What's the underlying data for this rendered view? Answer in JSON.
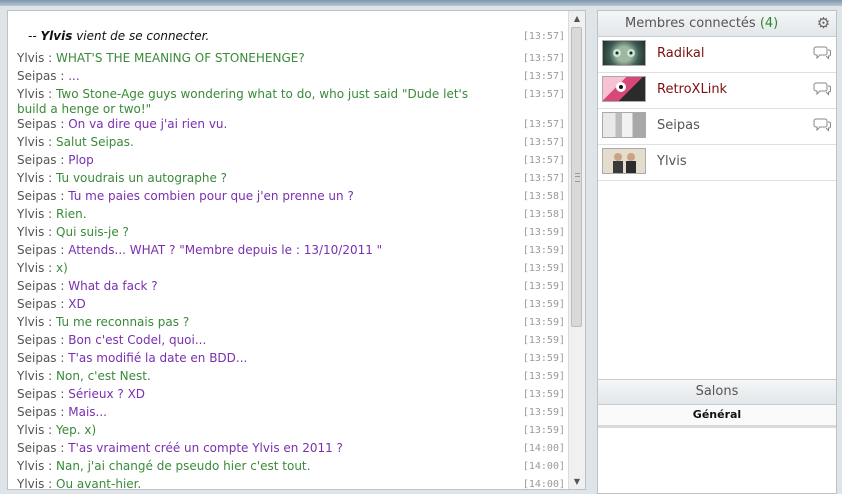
{
  "messages": [
    {
      "type": "system",
      "prefix": "-- ",
      "nick": "Ylvis",
      "text": " vient de se connecter.",
      "time": "[13:57]"
    },
    {
      "nick": "Ylvis",
      "sep": " : ",
      "text": "WHAT'S THE MEANING OF STONEHENGE?",
      "time": "[13:57]"
    },
    {
      "nick": "Seipas",
      "sep": " : ",
      "text": "...",
      "time": "[13:57]"
    },
    {
      "nick": "Ylvis",
      "sep": " : ",
      "text": "Two Stone-Age guys wondering what to do, who just said \"Dude let's build a henge or two!\"",
      "time": "[13:57]"
    },
    {
      "nick": "Seipas",
      "sep": " : ",
      "text": "On va dire que j'ai rien vu.",
      "time": "[13:57]"
    },
    {
      "nick": "Ylvis",
      "sep": " : ",
      "text": "Salut Seipas.",
      "time": "[13:57]"
    },
    {
      "nick": "Seipas",
      "sep": " : ",
      "text": "Plop",
      "time": "[13:57]"
    },
    {
      "nick": "Ylvis",
      "sep": " : ",
      "text": "Tu voudrais un autographe ?",
      "time": "[13:57]"
    },
    {
      "nick": "Seipas",
      "sep": " : ",
      "text": "Tu me paies combien pour que j'en prenne un ?",
      "time": "[13:58]"
    },
    {
      "nick": "Ylvis",
      "sep": " : ",
      "text": "Rien.",
      "time": "[13:58]"
    },
    {
      "nick": "Ylvis",
      "sep": " : ",
      "text": "Qui suis-je ?",
      "time": "[13:59]"
    },
    {
      "nick": "Seipas",
      "sep": " : ",
      "text": "Attends... WHAT ? \"Membre depuis le : 13/10/2011 \"",
      "time": "[13:59]"
    },
    {
      "nick": "Ylvis",
      "sep": " : ",
      "text": "x)",
      "time": "[13:59]"
    },
    {
      "nick": "Seipas",
      "sep": " : ",
      "text": "What da fack ?",
      "time": "[13:59]"
    },
    {
      "nick": "Seipas",
      "sep": " : ",
      "text": "XD",
      "time": "[13:59]"
    },
    {
      "nick": "Ylvis",
      "sep": " : ",
      "text": "Tu me reconnais pas ?",
      "time": "[13:59]"
    },
    {
      "nick": "Seipas",
      "sep": " : ",
      "text": "Bon c'est Codel, quoi...",
      "time": "[13:59]"
    },
    {
      "nick": "Seipas",
      "sep": " : ",
      "text": "T'as modifié la date en BDD...",
      "time": "[13:59]"
    },
    {
      "nick": "Ylvis",
      "sep": " : ",
      "text": "Non, c'est Nest.",
      "time": "[13:59]"
    },
    {
      "nick": "Seipas",
      "sep": " : ",
      "text": "Sérieux ? XD",
      "time": "[13:59]"
    },
    {
      "nick": "Seipas",
      "sep": " : ",
      "text": "Mais...",
      "time": "[13:59]"
    },
    {
      "nick": "Ylvis",
      "sep": " : ",
      "text": "Yep. x)",
      "time": "[13:59]"
    },
    {
      "nick": "Seipas",
      "sep": " : ",
      "text": "T'as vraiment créé un compte Ylvis en 2011 ?",
      "time": "[14:00]"
    },
    {
      "nick": "Ylvis",
      "sep": " : ",
      "text": "Nan, j'ai changé de pseudo hier c'est tout.",
      "time": "[14:00]"
    },
    {
      "nick": "Ylvis",
      "sep": " : ",
      "text": "Ou avant-hier.",
      "time": "[14:00]"
    }
  ],
  "sidebar": {
    "title": "Membres connectés",
    "count": "(4)",
    "members": [
      {
        "name": "Radikal",
        "avatar": "cat-avatar",
        "color": "#7b1111"
      },
      {
        "name": "RetroXLink",
        "avatar": "pink-bird-avatar",
        "color": "#7b1111"
      },
      {
        "name": "Seipas",
        "avatar": "anime-girl-avatar",
        "color": "#555555"
      },
      {
        "name": "Ylvis",
        "avatar": "two-men-avatar",
        "color": "#555555"
      }
    ],
    "salons_title": "Salons",
    "salons": [
      "Général"
    ]
  },
  "scrollbar": {
    "up": "▲",
    "down": "▼"
  },
  "icons": {
    "settings": "gear-icon",
    "private_message": "speech-bubble-icon"
  },
  "colors": {
    "ylvis_text": "#3a8a3a",
    "seipas_text": "#7a2fb0",
    "count": "#2f8a2f"
  }
}
